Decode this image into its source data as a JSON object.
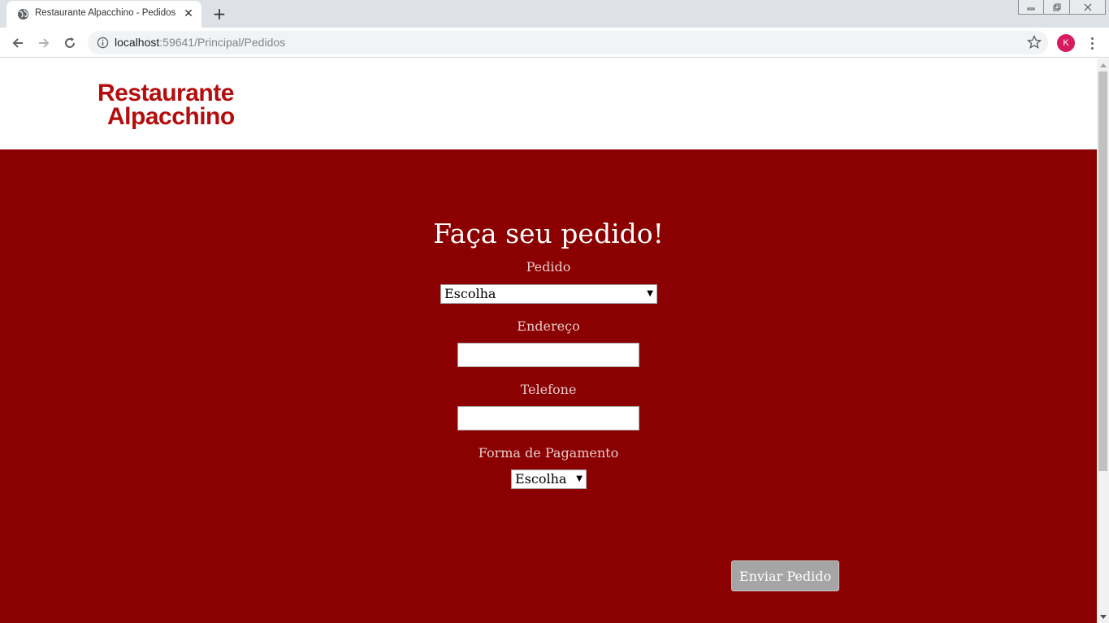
{
  "browser": {
    "tab_title": "Restaurante Alpacchino - Pedidos",
    "tab_close": "✕",
    "new_tab": "+",
    "url_host": "localhost",
    "url_rest": ":59641/Principal/Pedidos",
    "profile_initial": "K"
  },
  "site": {
    "logo_line1": "Restaurante",
    "logo_line2": "Alpacchino",
    "brand_color": "#b30d0d",
    "hero_color": "#8b0000"
  },
  "form": {
    "title": "Faça seu pedido!",
    "pedido_label": "Pedido",
    "pedido_selected": "Escolha",
    "endereco_label": "Endereço",
    "endereco_value": "",
    "telefone_label": "Telefone",
    "telefone_value": "",
    "pagamento_label": "Forma de Pagamento",
    "pagamento_selected": "Escolha",
    "submit_label": "Enviar Pedido"
  }
}
